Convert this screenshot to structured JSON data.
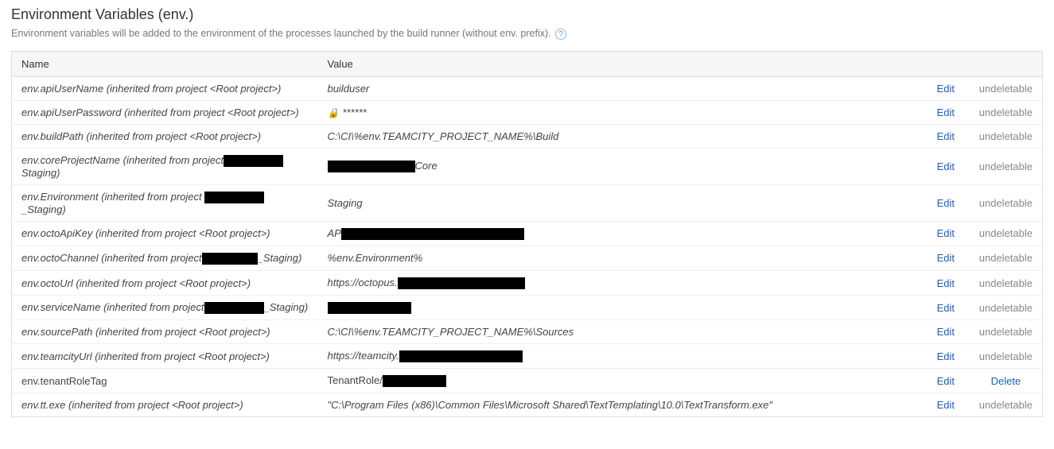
{
  "header": {
    "title": "Environment Variables (env.)",
    "description": "Environment variables will be added to the environment of the processes launched by the build runner (without env. prefix).",
    "help": "?"
  },
  "columns": {
    "name": "Name",
    "value": "Value"
  },
  "actions": {
    "edit": "Edit",
    "delete": "Delete",
    "undeletable": "undeletable"
  },
  "lockMask": "******",
  "rows": [
    {
      "name": "env.apiUserName (inherited from project <Root project>)",
      "valuePrefix": "builduser",
      "redactW": 0,
      "valueSuffix": "",
      "inherited": true,
      "locked": false,
      "redactName": false
    },
    {
      "name": "env.apiUserPassword (inherited from project <Root project>)",
      "valuePrefix": "",
      "redactW": 0,
      "valueSuffix": "",
      "inherited": true,
      "locked": true,
      "redactName": false
    },
    {
      "name": "env.buildPath (inherited from project <Root project>)",
      "valuePrefix": "C:\\CI\\%env.TEAMCITY_PROJECT_NAME%\\Build",
      "redactW": 0,
      "valueSuffix": "",
      "inherited": true,
      "locked": false,
      "redactName": false
    },
    {
      "name": "env.coreProjectName (inherited from project",
      "nameRedactW": 75,
      "nameSuffix": "Staging)",
      "valuePrefix": "",
      "redactW": 110,
      "valueSuffix": "Core",
      "inherited": true,
      "locked": false,
      "redactName": true
    },
    {
      "name": "env.Environment (inherited from project",
      "nameRedactW": 75,
      "nameSuffix": "_Staging)",
      "valuePrefix": "Staging",
      "redactW": 0,
      "valueSuffix": "",
      "inherited": true,
      "locked": false,
      "redactName": true,
      "nameSpace": true
    },
    {
      "name": "env.octoApiKey (inherited from project <Root project>)",
      "valuePrefix": "AP",
      "redactW": 230,
      "valueSuffix": "",
      "inherited": true,
      "locked": false,
      "redactName": false
    },
    {
      "name": "env.octoChannel (inherited from project",
      "nameRedactW": 70,
      "nameSuffix": "_Staging)",
      "valuePrefix": "%env.Environment%",
      "redactW": 0,
      "valueSuffix": "",
      "inherited": true,
      "locked": false,
      "redactName": true
    },
    {
      "name": "env.octoUrl (inherited from project <Root project>)",
      "valuePrefix": "https://octopus.",
      "redactW": 160,
      "valueSuffix": "",
      "inherited": true,
      "locked": false,
      "redactName": false
    },
    {
      "name": "env.serviceName (inherited from project",
      "nameRedactW": 75,
      "nameSuffix": "_Staging)",
      "valuePrefix": "",
      "redactW": 105,
      "valueSuffix": "",
      "inherited": true,
      "locked": false,
      "redactName": true
    },
    {
      "name": "env.sourcePath (inherited from project <Root project>)",
      "valuePrefix": "C:\\CI\\%env.TEAMCITY_PROJECT_NAME%\\Sources",
      "redactW": 0,
      "valueSuffix": "",
      "inherited": true,
      "locked": false,
      "redactName": false
    },
    {
      "name": "env.teamcityUrl (inherited from project <Root project>)",
      "valuePrefix": "https://teamcity.",
      "redactW": 155,
      "valueSuffix": "",
      "inherited": true,
      "locked": false,
      "redactName": false
    },
    {
      "name": "env.tenantRoleTag",
      "valuePrefix": "TenantRole/",
      "redactW": 80,
      "valueSuffix": "",
      "inherited": false,
      "locked": false,
      "redactName": false
    },
    {
      "name": "env.tt.exe (inherited from project <Root project>)",
      "valuePrefix": "\"C:\\Program Files (x86)\\Common Files\\Microsoft Shared\\TextTemplating\\10.0\\TextTransform.exe\"",
      "redactW": 0,
      "valueSuffix": "",
      "inherited": true,
      "locked": false,
      "redactName": false
    }
  ]
}
